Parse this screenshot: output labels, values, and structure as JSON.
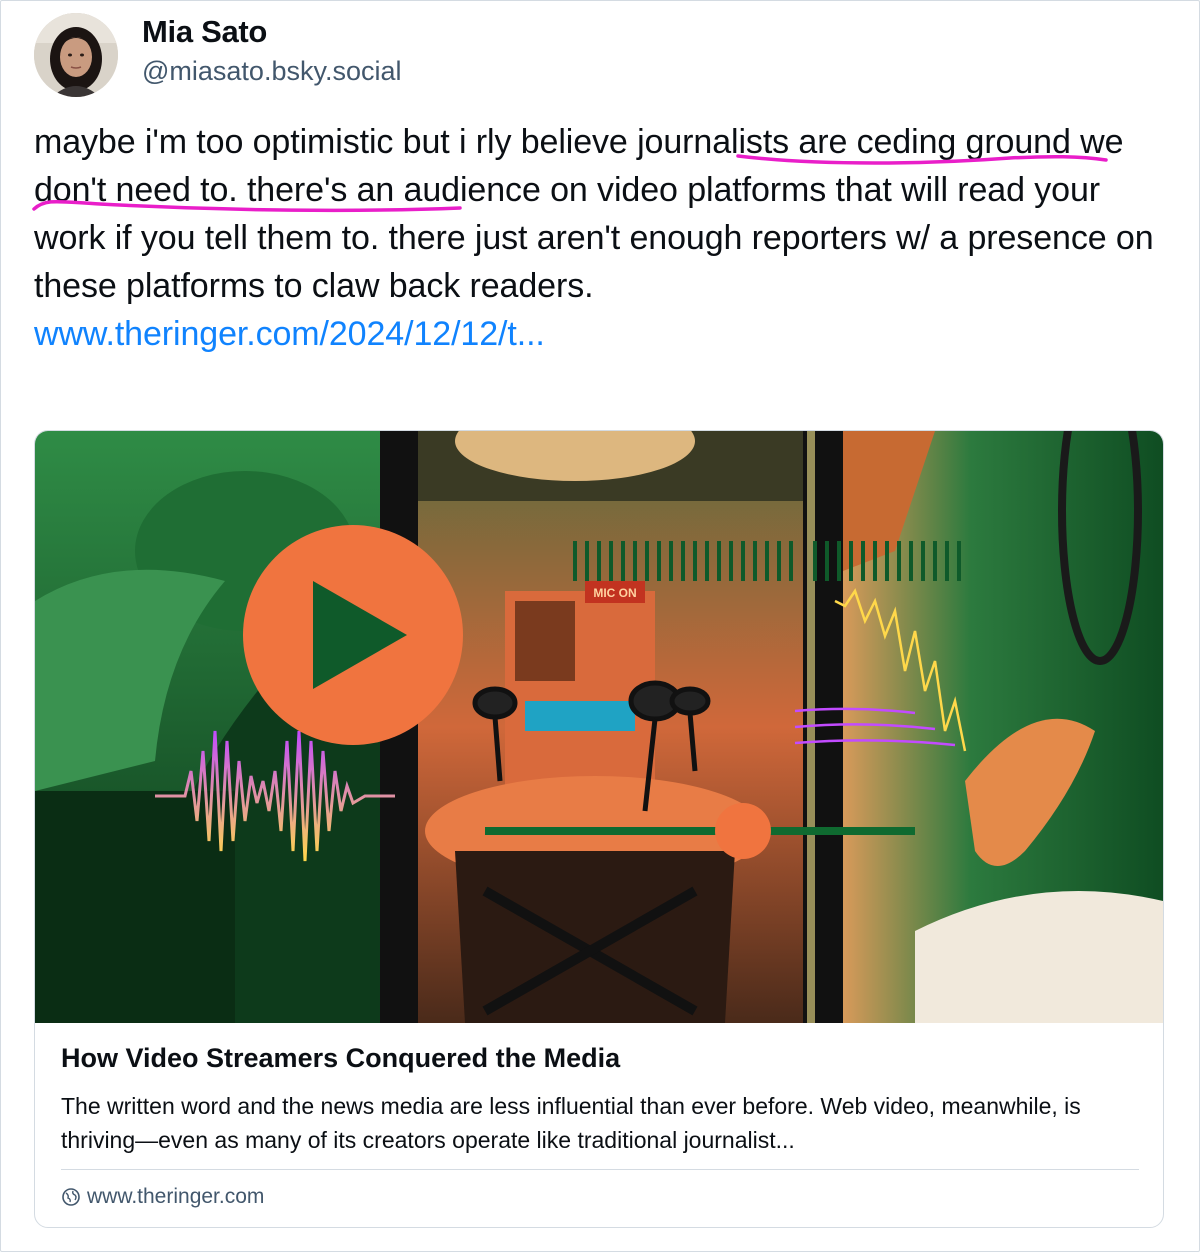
{
  "author": {
    "display_name": "Mia Sato",
    "handle": "@miasato.bsky.social",
    "avatar_icon": "avatar-photo"
  },
  "post": {
    "text_before": "maybe i'm too optimistic but i rly believe ",
    "text_highlight": "journalists are ceding ground we don't need to",
    "text_after": ". there's an audience on video platforms that will read your work if you tell them to. there just aren't enough reporters w/ a presence on these platforms to claw back readers.",
    "link_text": "www.theringer.com/2024/12/12/t...",
    "highlight_color": "#e91ec9"
  },
  "link_card": {
    "image_badge": "MIC ON",
    "title": "How Video Streamers Conquered the Media",
    "description": "The written word and the news media are less influential than ever before. Web video, meanwhile, is thriving—even as many of its creators operate like traditional journalist...",
    "domain": "www.theringer.com",
    "domain_icon": "globe-icon"
  },
  "colors": {
    "link": "#1083fe",
    "secondary_text": "#42576c",
    "thumb_green": "#0f5a2a",
    "thumb_orange": "#f0743f"
  }
}
